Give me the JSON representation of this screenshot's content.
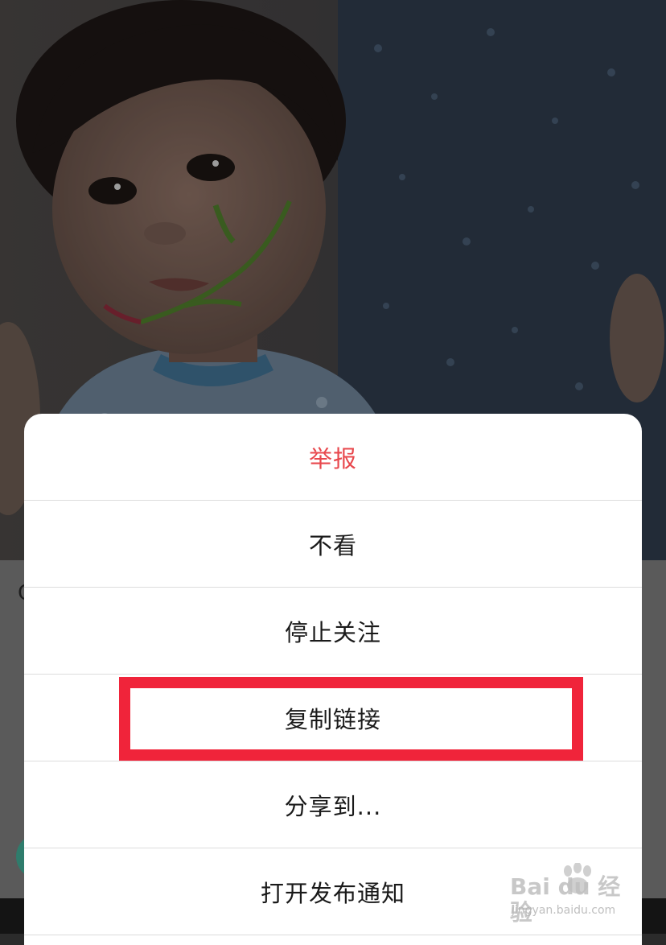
{
  "background": {
    "photo_alt": "child photo",
    "feed_letter": "C"
  },
  "action_sheet": {
    "items": [
      {
        "label": "举报",
        "style": "danger"
      },
      {
        "label": "不看",
        "style": "normal"
      },
      {
        "label": "停止关注",
        "style": "normal"
      },
      {
        "label": "复制链接",
        "style": "normal",
        "highlighted": true
      },
      {
        "label": "分享到...",
        "style": "normal"
      },
      {
        "label": "打开发布通知",
        "style": "normal"
      }
    ]
  },
  "colors": {
    "danger": "#e8484d",
    "highlight": "#f0243a",
    "text": "#1a1a1a"
  },
  "watermark": {
    "main": "Bai du 经验",
    "sub": "jingyan.baidu.com"
  }
}
